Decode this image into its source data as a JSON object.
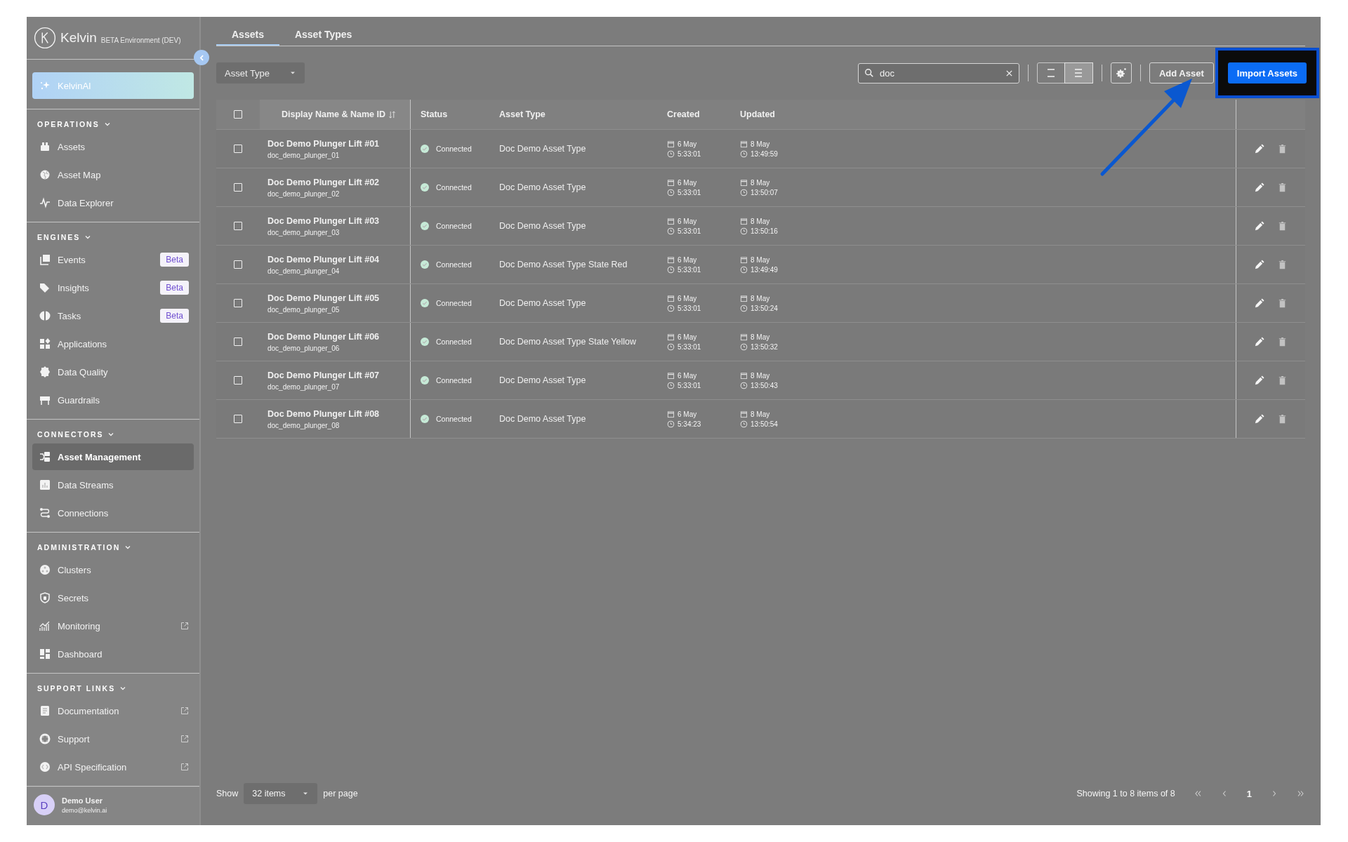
{
  "brand": {
    "name": "Kelvin",
    "environment": "BETA Environment (DEV)"
  },
  "assistant": {
    "label": "KelvinAI"
  },
  "sidebar": {
    "sections": [
      {
        "title": "OPERATIONS",
        "expanded": true,
        "items": [
          {
            "label": "Assets",
            "selected": false,
            "external": false
          },
          {
            "label": "Asset Map",
            "selected": false,
            "external": false
          },
          {
            "label": "Data Explorer",
            "selected": false,
            "external": false
          }
        ]
      },
      {
        "title": "ENGINES",
        "expanded": true,
        "items": [
          {
            "label": "Events",
            "selected": false,
            "external": false,
            "badge": "Beta"
          },
          {
            "label": "Insights",
            "selected": false,
            "external": false,
            "badge": "Beta"
          },
          {
            "label": "Tasks",
            "selected": false,
            "external": false,
            "badge": "Beta"
          },
          {
            "label": "Applications",
            "selected": false,
            "external": false
          },
          {
            "label": "Data Quality",
            "selected": false,
            "external": false
          },
          {
            "label": "Guardrails",
            "selected": false,
            "external": false
          }
        ]
      },
      {
        "title": "CONNECTORS",
        "expanded": true,
        "items": [
          {
            "label": "Asset Management",
            "selected": true,
            "external": false
          },
          {
            "label": "Data Streams",
            "selected": false,
            "external": false
          },
          {
            "label": "Connections",
            "selected": false,
            "external": false
          }
        ]
      },
      {
        "title": "ADMINISTRATION",
        "expanded": true,
        "items": [
          {
            "label": "Clusters",
            "selected": false,
            "external": false
          },
          {
            "label": "Secrets",
            "selected": false,
            "external": false
          },
          {
            "label": "Monitoring",
            "selected": false,
            "external": true
          },
          {
            "label": "Dashboard",
            "selected": false,
            "external": false
          }
        ]
      },
      {
        "title": "SUPPORT LINKS",
        "expanded": true,
        "items": [
          {
            "label": "Documentation",
            "selected": false,
            "external": true
          },
          {
            "label": "Support",
            "selected": false,
            "external": true
          },
          {
            "label": "API Specification",
            "selected": false,
            "external": true
          }
        ]
      }
    ]
  },
  "user": {
    "initial": "D",
    "name": "Demo User",
    "email": "demo@kelvin.ai"
  },
  "tabs": [
    {
      "label": "Assets",
      "selected": true
    },
    {
      "label": "Asset Types",
      "selected": false
    }
  ],
  "filter": {
    "placeholder": "Asset Type"
  },
  "search": {
    "value": "doc"
  },
  "view_toggle": [
    {
      "selected": false
    },
    {
      "selected": true
    }
  ],
  "buttons": [
    {
      "label": "Add Asset",
      "kind": "secondary",
      "highlighted": false
    },
    {
      "label": "Import Assets",
      "kind": "primary",
      "highlighted": true
    }
  ],
  "callout_arrow": true,
  "table": {
    "select_all": {
      "checked": false
    },
    "columns": [
      {
        "label": "Display Name & Name ID",
        "sortable": true
      },
      {
        "label": "Status"
      },
      {
        "label": "Asset Type"
      },
      {
        "label": "Created"
      },
      {
        "label": "Updated"
      }
    ],
    "rows": [
      {
        "checked": false,
        "name": "Doc Demo Plunger Lift #01",
        "name_id": "doc_demo_plunger_01",
        "status": "Connected",
        "asset_type": "Doc Demo Asset Type",
        "created_date": "6 May",
        "created_time": "5:33:01",
        "updated_date": "8 May",
        "updated_time": "13:49:59",
        "delete_disabled": true
      },
      {
        "checked": false,
        "name": "Doc Demo Plunger Lift #02",
        "name_id": "doc_demo_plunger_02",
        "status": "Connected",
        "asset_type": "Doc Demo Asset Type",
        "created_date": "6 May",
        "created_time": "5:33:01",
        "updated_date": "8 May",
        "updated_time": "13:50:07",
        "delete_disabled": true
      },
      {
        "checked": false,
        "name": "Doc Demo Plunger Lift #03",
        "name_id": "doc_demo_plunger_03",
        "status": "Connected",
        "asset_type": "Doc Demo Asset Type",
        "created_date": "6 May",
        "created_time": "5:33:01",
        "updated_date": "8 May",
        "updated_time": "13:50:16",
        "delete_disabled": true
      },
      {
        "checked": false,
        "name": "Doc Demo Plunger Lift #04",
        "name_id": "doc_demo_plunger_04",
        "status": "Connected",
        "asset_type": "Doc Demo Asset Type State Red",
        "created_date": "6 May",
        "created_time": "5:33:01",
        "updated_date": "8 May",
        "updated_time": "13:49:49",
        "delete_disabled": true
      },
      {
        "checked": false,
        "name": "Doc Demo Plunger Lift #05",
        "name_id": "doc_demo_plunger_05",
        "status": "Connected",
        "asset_type": "Doc Demo Asset Type",
        "created_date": "6 May",
        "created_time": "5:33:01",
        "updated_date": "8 May",
        "updated_time": "13:50:24",
        "delete_disabled": true
      },
      {
        "checked": false,
        "name": "Doc Demo Plunger Lift #06",
        "name_id": "doc_demo_plunger_06",
        "status": "Connected",
        "asset_type": "Doc Demo Asset Type State Yellow",
        "created_date": "6 May",
        "created_time": "5:33:01",
        "updated_date": "8 May",
        "updated_time": "13:50:32",
        "delete_disabled": true
      },
      {
        "checked": false,
        "name": "Doc Demo Plunger Lift #07",
        "name_id": "doc_demo_plunger_07",
        "status": "Connected",
        "asset_type": "Doc Demo Asset Type",
        "created_date": "6 May",
        "created_time": "5:33:01",
        "updated_date": "8 May",
        "updated_time": "13:50:43",
        "delete_disabled": true
      },
      {
        "checked": false,
        "name": "Doc Demo Plunger Lift #08",
        "name_id": "doc_demo_plunger_08",
        "status": "Connected",
        "asset_type": "Doc Demo Asset Type",
        "created_date": "6 May",
        "created_time": "5:34:23",
        "updated_date": "8 May",
        "updated_time": "13:50:54",
        "delete_disabled": true
      }
    ]
  },
  "footer": {
    "show_label": "Show",
    "page_size": "32 items",
    "per_page_label": "per page",
    "summary": "Showing 1 to 8 items of 8",
    "pages": [
      {
        "label": "1",
        "selected": true
      }
    ]
  }
}
